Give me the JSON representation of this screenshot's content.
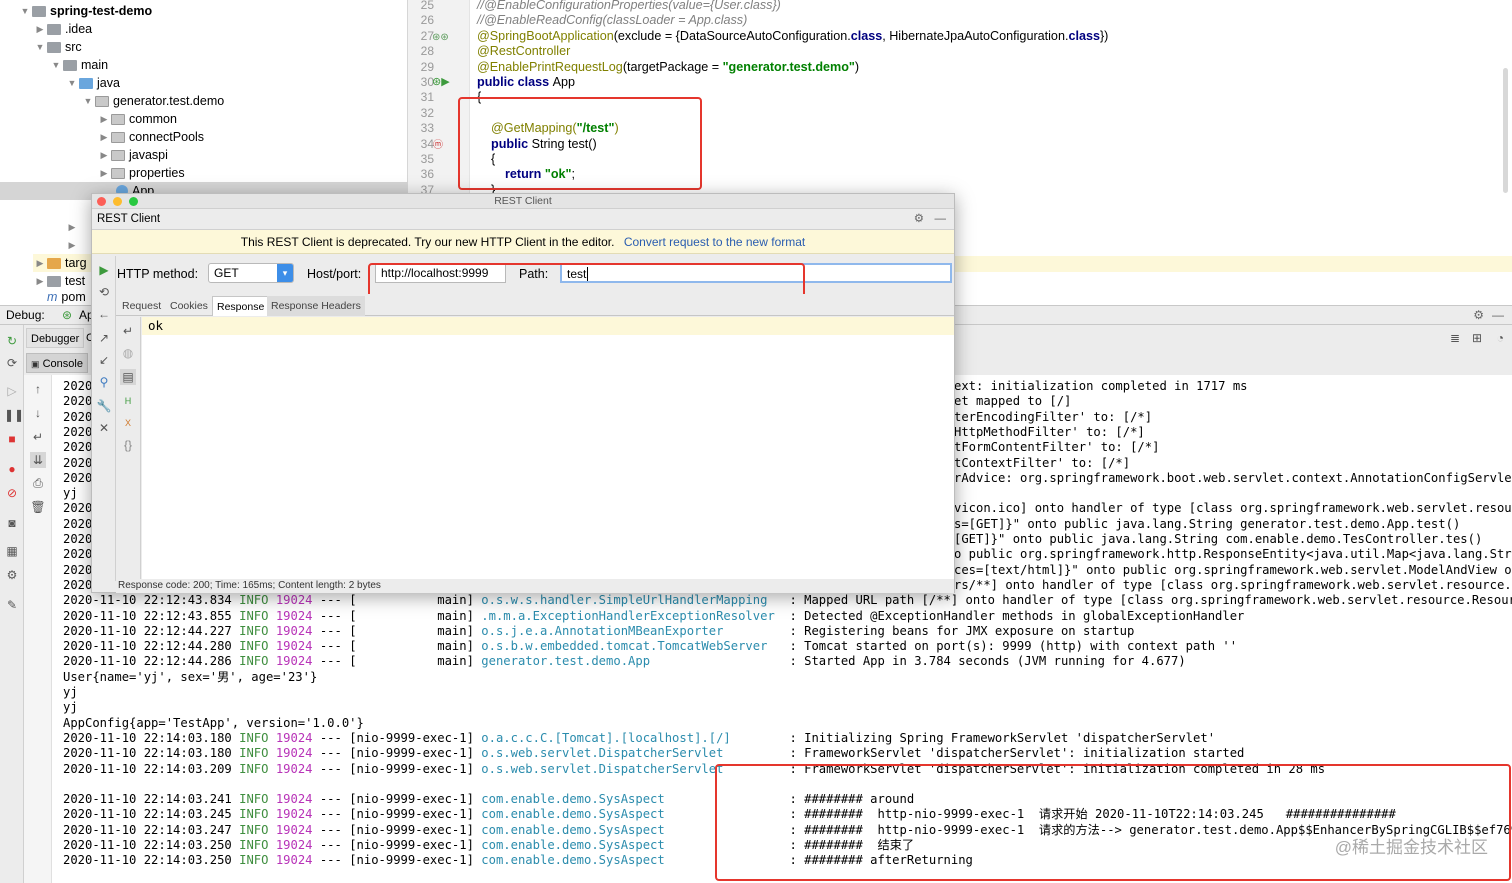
{
  "project_tree": {
    "items": [
      {
        "label": "spring-test-demo",
        "bold": true
      },
      {
        "label": ".idea"
      },
      {
        "label": "src"
      },
      {
        "label": "main"
      },
      {
        "label": "java"
      },
      {
        "label": "generator.test.demo"
      },
      {
        "label": "common"
      },
      {
        "label": "connectPools"
      },
      {
        "label": "javaspi"
      },
      {
        "label": "properties"
      },
      {
        "label": "App"
      },
      {
        "label": "targ"
      },
      {
        "label": "test"
      },
      {
        "label": "pom"
      }
    ]
  },
  "editor": {
    "lines": [
      {
        "no": "25",
        "text": "//@EnableConfigurationProperties(value={User.class})"
      },
      {
        "no": "26",
        "text": "//@EnableReadConfig(classLoader = App.class)"
      },
      {
        "no": "27",
        "a": "@SpringBootApplication",
        "b": "(exclude = {DataSourceAutoConfiguration.",
        "c": "class",
        "d": ", HibernateJpaAutoConfiguration.",
        "e": "class",
        "f": "})"
      },
      {
        "no": "28",
        "text": "@RestController"
      },
      {
        "no": "29",
        "a": "@EnablePrintRequestLog",
        "b": "(targetPackage = ",
        "c": "\"generator.test.demo\"",
        "d": ")"
      },
      {
        "no": "30",
        "a": "public class ",
        "b": "App"
      },
      {
        "no": "31",
        "text": "{"
      },
      {
        "no": "32",
        "text": ""
      },
      {
        "no": "33",
        "a": "    @GetMapping(",
        "b": "\"/test\"",
        "c": ")"
      },
      {
        "no": "34",
        "a": "    public ",
        "b": "String test()"
      },
      {
        "no": "35",
        "text": "    {"
      },
      {
        "no": "36",
        "a": "        return ",
        "b": "\"ok\"",
        "c": ";"
      },
      {
        "no": "37",
        "text": "    }"
      }
    ]
  },
  "debug": {
    "label": "Debug:",
    "run_config": "Ap",
    "tabs": [
      "Debugger",
      "C"
    ],
    "console_tab": "Console"
  },
  "rest_client": {
    "window_title": "REST Client",
    "panel_title": "REST Client",
    "notice": "This REST Client is deprecated. Try our new HTTP Client in the editor.",
    "notice_link": "Convert request to the new format",
    "http_method_label": "HTTP method:",
    "http_method": "GET",
    "host_label": "Host/port:",
    "host": "http://localhost:9999",
    "path_label": "Path:",
    "path": "test",
    "tabs": [
      "Request",
      "Cookies",
      "Response",
      "Response Headers"
    ],
    "active_tab": "Response",
    "response_body": "ok",
    "status": "Response code: 200; Time: 165ms; Content length: 2 bytes"
  },
  "console": {
    "partial_prefix": [
      "2020",
      "2020",
      "2020",
      "2020",
      "2020",
      "2020",
      "2020",
      "yj",
      "2020",
      "2020",
      "2020",
      "2020",
      "2020",
      "2020"
    ],
    "partial_right": [
      "ext: initialization completed in 1717 ms",
      "et mapped to [/]",
      "terEncodingFilter' to: [/*]",
      "HttpMethodFilter' to: [/*]",
      "tFormContentFilter' to: [/*]",
      "tContextFilter' to: [/*]",
      "rAdvice: org.springframework.boot.web.servlet.context.AnnotationConfigServletW",
      "",
      "vicon.ico] onto handler of type [class org.springframework.web.servlet.resour",
      "s=[GET]}\" onto public java.lang.String generator.test.demo.App.test()",
      "[GET]}\" onto public java.lang.String com.enable.demo.TesController.tes()",
      "o public org.springframework.http.ResponseEntity<java.util.Map<java.lang.Stri",
      "ces=[text/html]}\" onto public org.springframework.web.servlet.ModelAndView or",
      "rs/**] onto handler of type [class org.springframework.web.servlet.resource.R"
    ],
    "lines": [
      {
        "ts": "2020-11-10 22:12:43.834",
        "lvl": "INFO",
        "pid": "19024",
        "thread": "--- [           main]",
        "logger": "o.s.w.s.handler.SimpleUrlHandlerMapping ",
        "msg": "  : Mapped URL path [/**] onto handler of type [class org.springframework.web.servlet.resource.ResourceH"
      },
      {
        "ts": "2020-11-10 22:12:43.855",
        "lvl": "INFO",
        "pid": "19024",
        "thread": "--- [           main]",
        "logger": ".m.m.a.ExceptionHandlerExceptionResolver",
        "msg": "  : Detected @ExceptionHandler methods in globalExceptionHandler"
      },
      {
        "ts": "2020-11-10 22:12:44.227",
        "lvl": "INFO",
        "pid": "19024",
        "thread": "--- [           main]",
        "logger": "o.s.j.e.a.AnnotationMBeanExporter       ",
        "msg": "  : Registering beans for JMX exposure on startup"
      },
      {
        "ts": "2020-11-10 22:12:44.280",
        "lvl": "INFO",
        "pid": "19024",
        "thread": "--- [           main]",
        "logger": "o.s.b.w.embedded.tomcat.TomcatWebServer ",
        "msg": "  : Tomcat started on port(s): 9999 (http) with context path ''"
      },
      {
        "ts": "2020-11-10 22:12:44.286",
        "lvl": "INFO",
        "pid": "19024",
        "thread": "--- [           main]",
        "logger": "generator.test.demo.App                 ",
        "msg": "  : Started App in 3.784 seconds (JVM running for 4.677)"
      },
      {
        "plain": "User{name='yj', sex='男', age='23'}"
      },
      {
        "plain": "yj"
      },
      {
        "plain": "yj"
      },
      {
        "plain": "AppConfig{app='TestApp', version='1.0.0'}"
      },
      {
        "ts": "2020-11-10 22:14:03.180",
        "lvl": "INFO",
        "pid": "19024",
        "thread": "--- [nio-9999-exec-1]",
        "logger": "o.a.c.c.C.[Tomcat].[localhost].[/]      ",
        "msg": "  : Initializing Spring FrameworkServlet 'dispatcherServlet'"
      },
      {
        "ts": "2020-11-10 22:14:03.180",
        "lvl": "INFO",
        "pid": "19024",
        "thread": "--- [nio-9999-exec-1]",
        "logger": "o.s.web.servlet.DispatcherServlet       ",
        "msg": "  : FrameworkServlet 'dispatcherServlet': initialization started"
      },
      {
        "ts": "2020-11-10 22:14:03.209",
        "lvl": "INFO",
        "pid": "19024",
        "thread": "--- [nio-9999-exec-1]",
        "logger": "o.s.web.servlet.DispatcherServlet       ",
        "msg": "  : FrameworkServlet 'dispatcherServlet': initialization completed in 28 ms"
      },
      {
        "plain": ""
      },
      {
        "ts": "2020-11-10 22:14:03.241",
        "lvl": "INFO",
        "pid": "19024",
        "thread": "--- [nio-9999-exec-1]",
        "logger": "com.enable.demo.SysAspect               ",
        "msg": "  : ######## around"
      },
      {
        "ts": "2020-11-10 22:14:03.245",
        "lvl": "INFO",
        "pid": "19024",
        "thread": "--- [nio-9999-exec-1]",
        "logger": "com.enable.demo.SysAspect               ",
        "msg": "  : ########  http-nio-9999-exec-1  请求开始 2020-11-10T22:14:03.245   ###############"
      },
      {
        "ts": "2020-11-10 22:14:03.247",
        "lvl": "INFO",
        "pid": "19024",
        "thread": "--- [nio-9999-exec-1]",
        "logger": "com.enable.demo.SysAspect               ",
        "msg": "  : ########  http-nio-9999-exec-1  请求的方法--> generator.test.demo.App$$EnhancerBySpringCGLIB$$ef76998"
      },
      {
        "ts": "2020-11-10 22:14:03.250",
        "lvl": "INFO",
        "pid": "19024",
        "thread": "--- [nio-9999-exec-1]",
        "logger": "com.enable.demo.SysAspect               ",
        "msg": "  : ########  结束了"
      },
      {
        "ts": "2020-11-10 22:14:03.250",
        "lvl": "INFO",
        "pid": "19024",
        "thread": "--- [nio-9999-exec-1]",
        "logger": "com.enable.demo.SysAspect               ",
        "msg": "  : ######## afterReturning"
      }
    ]
  },
  "watermark": "@稀土掘金技术社区"
}
